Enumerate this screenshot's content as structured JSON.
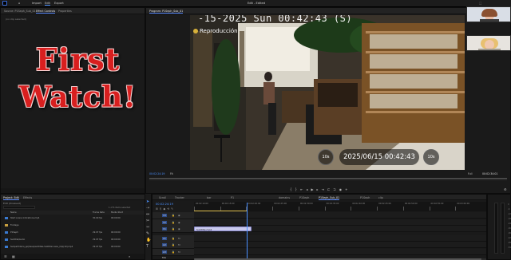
{
  "app": {
    "title": "Edit - Edited",
    "menu": [
      "Import",
      "Edit",
      "Export"
    ],
    "active_menu": "Edit"
  },
  "source_panel": {
    "tabs": [
      "Source: P1Seph_Sub_01",
      "Effect Controls",
      "Properties"
    ],
    "active_tab": "Effect Controls",
    "status": "(no clip selected)"
  },
  "overlay_text": {
    "line1": "First",
    "line2": "Watch!"
  },
  "program_panel": {
    "tab": "Program: P1Seph_Sub_01",
    "timecode_left": "00:02:24:19",
    "fit": "Fit",
    "quality": "Full",
    "timecode_right": "00:02:34:01"
  },
  "video": {
    "cam_timestamp": "-15-2025 Sun 00:42:43 (S)",
    "cam_label": "Reproducción",
    "rewind_label": "10s",
    "forward_label": "10s",
    "datetime": "2025/06/15 00:42:43"
  },
  "project_panel": {
    "tabs": [
      "Project: Edit",
      "Effects"
    ],
    "subtitle": "Edit (Unsaved)",
    "item_count": "1 of 6 items selected",
    "columns": [
      "Name",
      "Frame Rate",
      "Media Start"
    ],
    "rows": [
      {
        "name": "Start scene Indications.mp4",
        "rate": "30.00 fps",
        "start": "00:00:00"
      },
      {
        "name": "Footage",
        "rate": "",
        "start": ""
      },
      {
        "name": "P1Seph",
        "rate": "29.97 fps",
        "start": "00:00:00"
      },
      {
        "name": "Subtitle/Audio",
        "rate": "29.97 fps",
        "start": "00:00:00"
      },
      {
        "name": "Subpartidaria_ep(base)subtitles-Subtitle1.wav_Clip(10).mp4",
        "rate": "29.97 fps",
        "start": "00:00:00"
      }
    ]
  },
  "timeline": {
    "tabs": [
      "Scroll",
      "Tracker",
      "bar",
      "P1",
      "domains",
      "P1Seph",
      "P1Seph_Sub_01",
      "P1Seph",
      "clip"
    ],
    "active_tab": "P1Seph_Sub_01",
    "timecode": "00:02:24:19",
    "ruler": [
      "00:02:10:00",
      "00:02:15:00",
      "00:02:20:00",
      "00:02:25:00",
      "00:02:30:00",
      "00:02:35:00",
      "00:02:40:00",
      "00:02:45:00",
      "00:02:50:00",
      "00:02:55:00",
      "00:03:00:00"
    ],
    "video_tracks": [
      "V3",
      "V2",
      "V1"
    ],
    "audio_tracks": [
      "A1",
      "A2",
      "A3"
    ],
    "clip_label": "Subtitle.mp4",
    "mix_label": "Mix"
  },
  "colors": {
    "accent": "#4a90ff",
    "clip_audio": "#2f5fae",
    "overlay_red": "#d81f1f",
    "playhead": "#4a90ff"
  },
  "icons": [
    "search-icon",
    "play-icon",
    "rewind-10-icon",
    "forward-10-icon",
    "wrench-icon",
    "selection-tool-icon",
    "razor-tool-icon",
    "hand-tool-icon",
    "text-tool-icon"
  ]
}
